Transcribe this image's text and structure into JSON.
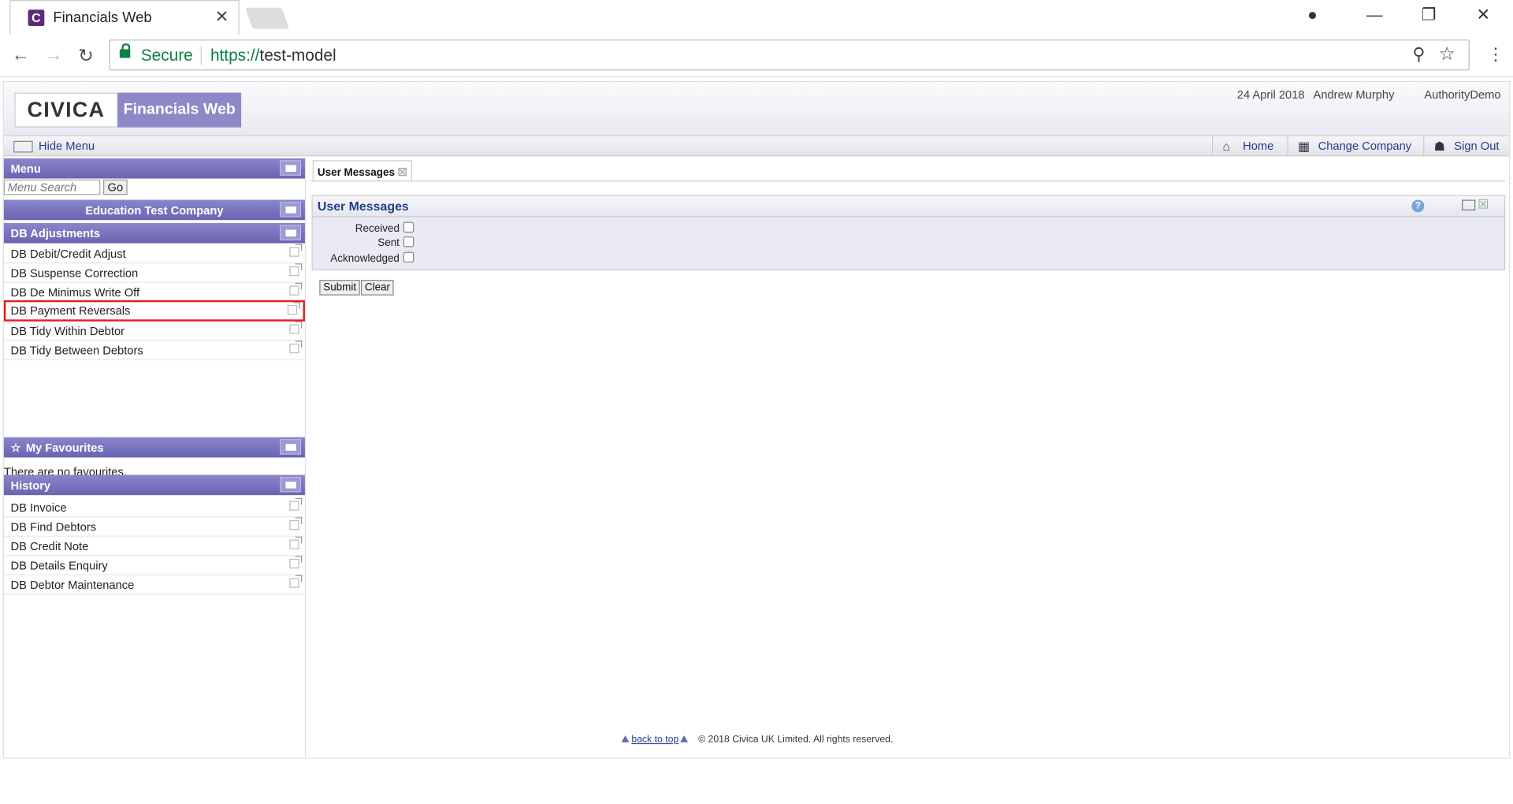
{
  "browser": {
    "tab_title": "Financials Web",
    "tab_favicon": "C",
    "close_glyph": "✕",
    "secure_label": "Secure",
    "url_scheme": "https://",
    "url_host": "test-model"
  },
  "header": {
    "logo": "CIVICA",
    "product": "Financials Web",
    "date": "24 April 2018",
    "user": "Andrew Murphy",
    "authority": "AuthorityDemo"
  },
  "toolbar": {
    "hide_menu": "Hide Menu",
    "home": "Home",
    "change_company": "Change Company",
    "sign_out": "Sign Out"
  },
  "sidebar": {
    "menu_title": "Menu",
    "search_placeholder": "Menu Search",
    "go_label": "Go",
    "company": "Education Test Company",
    "section_title": "DB Adjustments",
    "items": [
      {
        "label": "DB Debit/Credit Adjust"
      },
      {
        "label": "DB Suspense Correction"
      },
      {
        "label": "DB De Minimus Write Off"
      },
      {
        "label": "DB Payment Reversals",
        "highlighted": true
      },
      {
        "label": "DB Tidy Within Debtor"
      },
      {
        "label": "DB Tidy Between Debtors"
      }
    ],
    "favourites_title": "My Favourites",
    "favourites_empty": "There are no favourites.",
    "history_title": "History",
    "history_items": [
      {
        "label": "DB Invoice"
      },
      {
        "label": "DB Find Debtors"
      },
      {
        "label": "DB Credit Note"
      },
      {
        "label": "DB Details Enquiry"
      },
      {
        "label": "DB Debtor Maintenance"
      }
    ]
  },
  "main": {
    "tab_label": "User Messages",
    "panel_title": "User Messages",
    "help_glyph": "?",
    "filters": [
      {
        "label": "Received",
        "checked": false
      },
      {
        "label": "Sent",
        "checked": false
      },
      {
        "label": "Acknowledged",
        "checked": false
      }
    ],
    "submit_label": "Submit",
    "clear_label": "Clear"
  },
  "footer": {
    "back_to_top": "back to top",
    "copyright": "© 2018 Civica UK Limited. All rights reserved."
  },
  "colors": {
    "accent": "#6a64b1",
    "link": "#223f8a",
    "secure": "#0b8043",
    "highlight_border": "#e81c24"
  }
}
